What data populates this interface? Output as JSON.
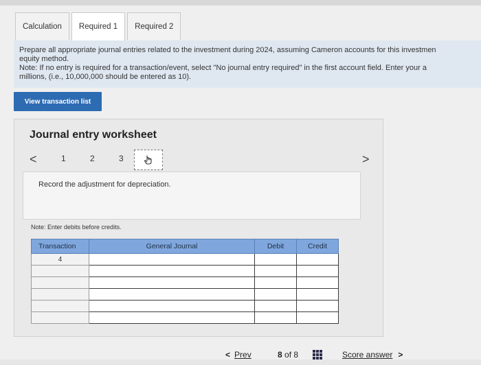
{
  "tabs": [
    {
      "label": "Calculation"
    },
    {
      "label": "Required 1"
    },
    {
      "label": "Required 2"
    }
  ],
  "instructions": {
    "line1": "Prepare all appropriate journal entries related to the investment during 2024, assuming Cameron accounts for this investmen",
    "line2": "equity method.",
    "line3": "Note: If no entry is required for a transaction/event, select \"No journal entry required\" in the first account field. Enter your a",
    "line4": "millions, (i.e., 10,000,000 should be entered as 10)."
  },
  "view_button": "View transaction list",
  "worksheet": {
    "title": "Journal entry worksheet",
    "pages": [
      "1",
      "2",
      "3"
    ],
    "prev_glyph": "<",
    "next_glyph": ">",
    "description": "Record the adjustment for depreciation.",
    "note": "Note: Enter debits before credits."
  },
  "table": {
    "headers": [
      "Transaction",
      "General Journal",
      "Debit",
      "Credit"
    ],
    "rows": [
      {
        "transaction": "4"
      },
      {
        "transaction": ""
      },
      {
        "transaction": ""
      },
      {
        "transaction": ""
      },
      {
        "transaction": ""
      },
      {
        "transaction": ""
      }
    ]
  },
  "footer": {
    "prev": "Prev",
    "count_current": "8",
    "count_of": "of",
    "count_total": "8",
    "score": "Score answer"
  }
}
